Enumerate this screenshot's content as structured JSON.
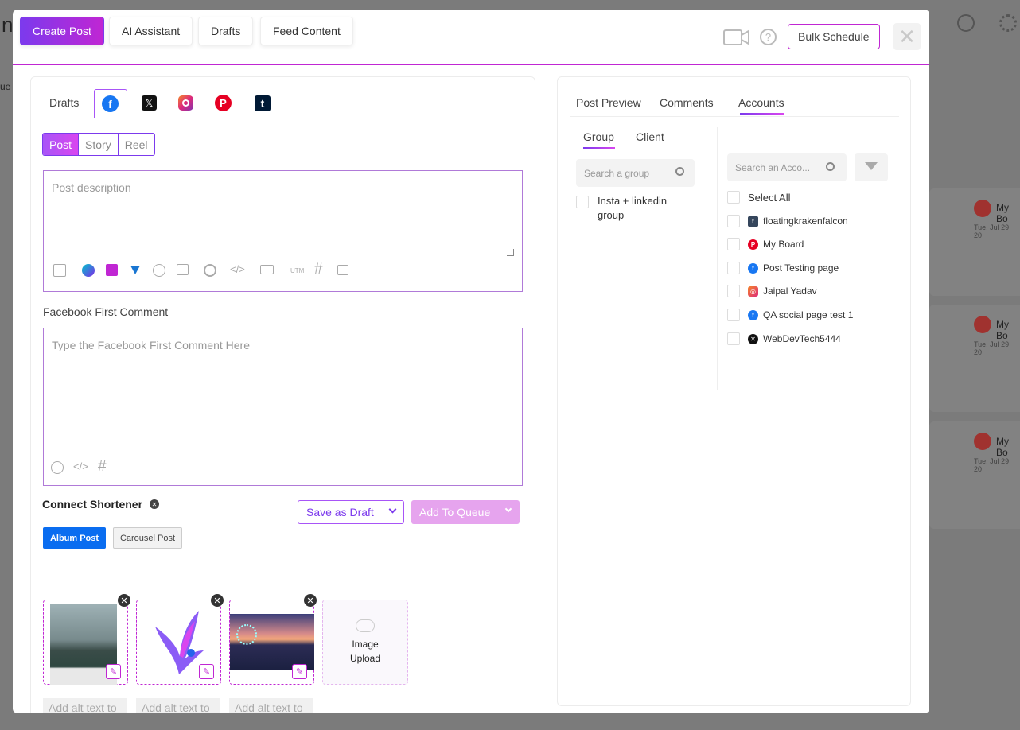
{
  "background": {
    "left_letter": "n",
    "left_fragment": "ue",
    "cards": [
      {
        "account": "My Bo",
        "date": "Tue, Jul 29, 20"
      },
      {
        "account": "My Bo",
        "date": "Tue, Jul 29, 20"
      },
      {
        "account": "My Bo",
        "date": "Tue, Jul 29, 20"
      }
    ]
  },
  "header": {
    "tabs": [
      "Create Post",
      "AI Assistant",
      "Drafts",
      "Feed Content"
    ],
    "bulk_schedule": "Bulk Schedule",
    "close": "✕",
    "help": "?"
  },
  "composer": {
    "platform_tabs": {
      "drafts": "Drafts"
    },
    "platform_letters": {
      "facebook": "f",
      "x": "𝕏",
      "pinterest": "P",
      "tumblr": "t"
    },
    "post_types": [
      "Post",
      "Story",
      "Reel"
    ],
    "description_placeholder": "Post description",
    "first_comment_label": "Facebook First Comment",
    "first_comment_placeholder": "Type the Facebook First Comment Here",
    "shortener_label": "Connect Shortener",
    "save_draft": "Save as Draft",
    "add_queue": "Add To Queue",
    "album_post": "Album Post",
    "carousel_post": "Carousel Post",
    "image_upload_line1": "Image",
    "image_upload_line2": "Upload",
    "alt_placeholder": "Add alt text to",
    "toolbar_utm": "UTM",
    "toolbar_hash": "#"
  },
  "right_panel": {
    "tabs": [
      "Post Preview",
      "Comments",
      "Accounts"
    ],
    "sub_tabs": [
      "Group",
      "Client"
    ],
    "group_search_placeholder": "Search a group",
    "group_item": "Insta + linkedin group",
    "account_search_placeholder": "Search an Acco...",
    "select_all": "Select All",
    "accounts": [
      {
        "name": "floatingkrakenfalcon",
        "platform": "tumblr",
        "color": "#35465c",
        "glyph": "t"
      },
      {
        "name": "My Board",
        "platform": "pinterest",
        "color": "#e60023",
        "glyph": "P"
      },
      {
        "name": "Post Testing page",
        "platform": "facebook",
        "color": "#1877f2",
        "glyph": "f"
      },
      {
        "name": "Jaipal Yadav",
        "platform": "instagram",
        "color": "#e1306c",
        "glyph": "◎"
      },
      {
        "name": "QA social page test 1",
        "platform": "facebook",
        "color": "#1877f2",
        "glyph": "f"
      },
      {
        "name": "WebDevTech5444",
        "platform": "x",
        "color": "#111111",
        "glyph": "✕"
      }
    ]
  }
}
